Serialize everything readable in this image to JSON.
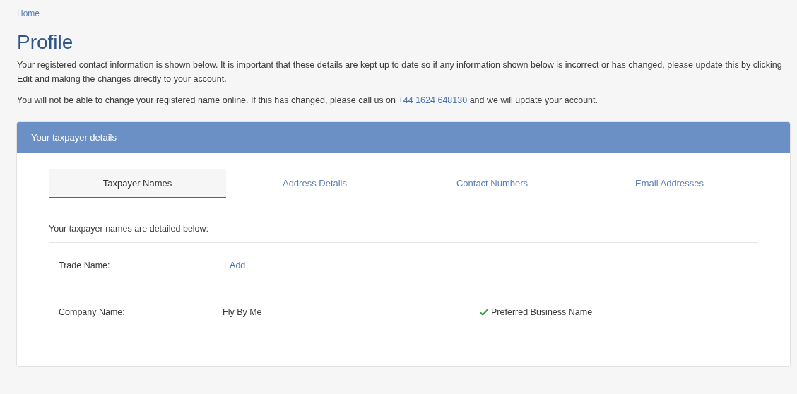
{
  "breadcrumb": "Home",
  "title": "Profile",
  "intro": "Your registered contact information is shown below. It is important that these details are kept up to date so if any information shown below is incorrect or has changed, please update this by clicking Edit and making the changes directly to your account.",
  "notice": {
    "before": "You will not be able to change your registered name online. If this has changed, please call us on",
    "phone": "+44 1624 648130",
    "after": "and we will update your account."
  },
  "panel": {
    "title": "Your taxpayer details",
    "tabs": [
      {
        "label": "Taxpayer Names",
        "selected": true
      },
      {
        "label": "Address Details",
        "selected": false
      },
      {
        "label": "Contact Numbers",
        "selected": false
      },
      {
        "label": "Email Addresses",
        "selected": false
      }
    ],
    "description": "Your taxpayer names are detailed below:",
    "rows": [
      {
        "label": "Trade Name:",
        "value": {
          "kind": "link",
          "text": "+ Add"
        }
      },
      {
        "label": "Company Name:",
        "value": {
          "kind": "text",
          "text": "Fly By Me"
        },
        "status": "Preferred Business Name"
      }
    ]
  }
}
